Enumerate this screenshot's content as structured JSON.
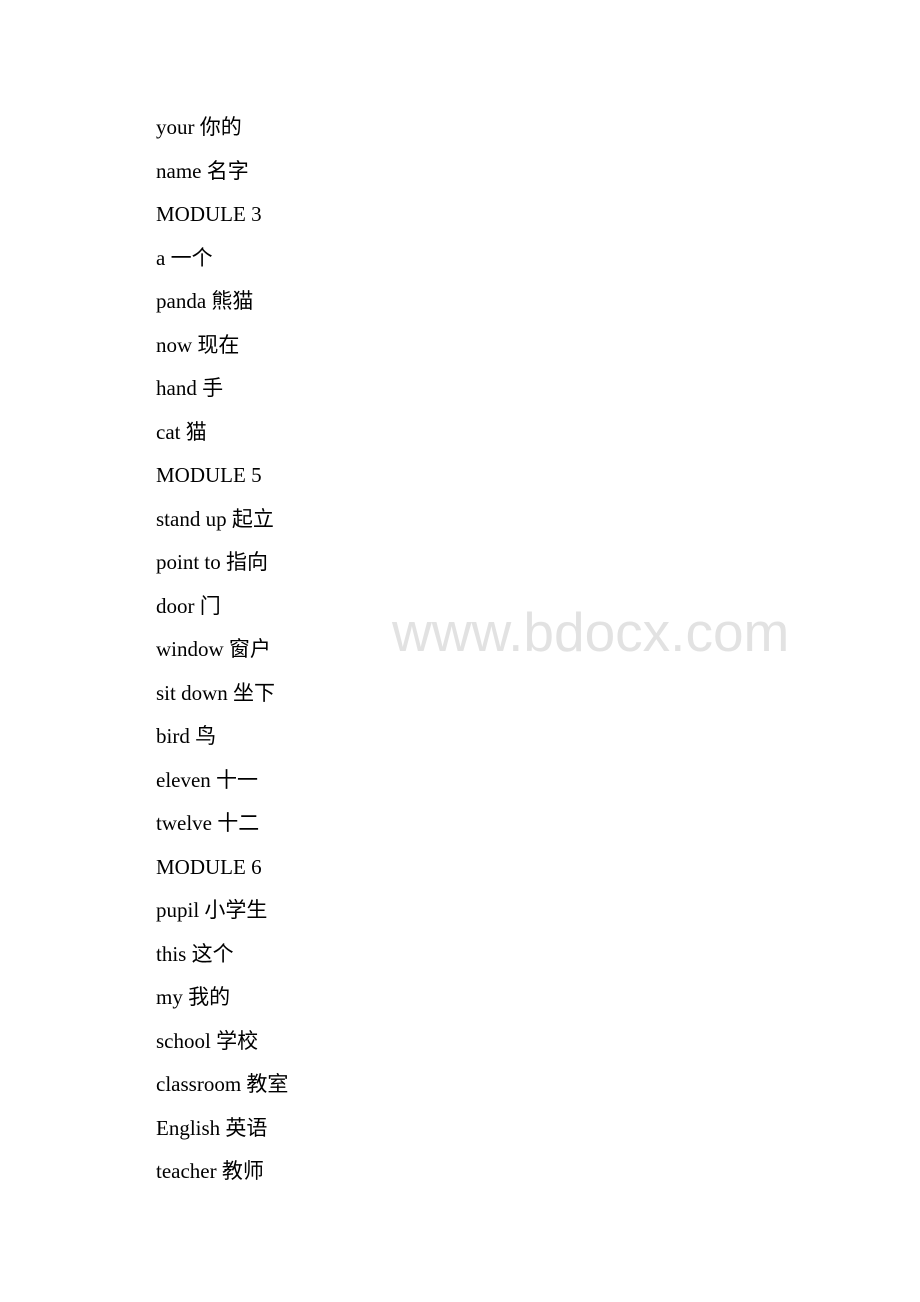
{
  "document": {
    "lines": [
      "your 你的",
      "name 名字",
      "MODULE 3",
      "a 一个",
      "panda 熊猫",
      "now 现在",
      "hand 手",
      "cat 猫",
      "MODULE 5",
      "stand up 起立",
      "point to 指向",
      "door 门",
      "window 窗户",
      "sit down 坐下",
      "bird 鸟",
      "eleven 十一",
      "twelve 十二",
      "MODULE 6",
      "pupil 小学生",
      "this 这个",
      "my 我的",
      "school 学校",
      "classroom 教室",
      "English 英语",
      "teacher 教师"
    ]
  },
  "watermark": {
    "text": "www.bdocx.com"
  }
}
